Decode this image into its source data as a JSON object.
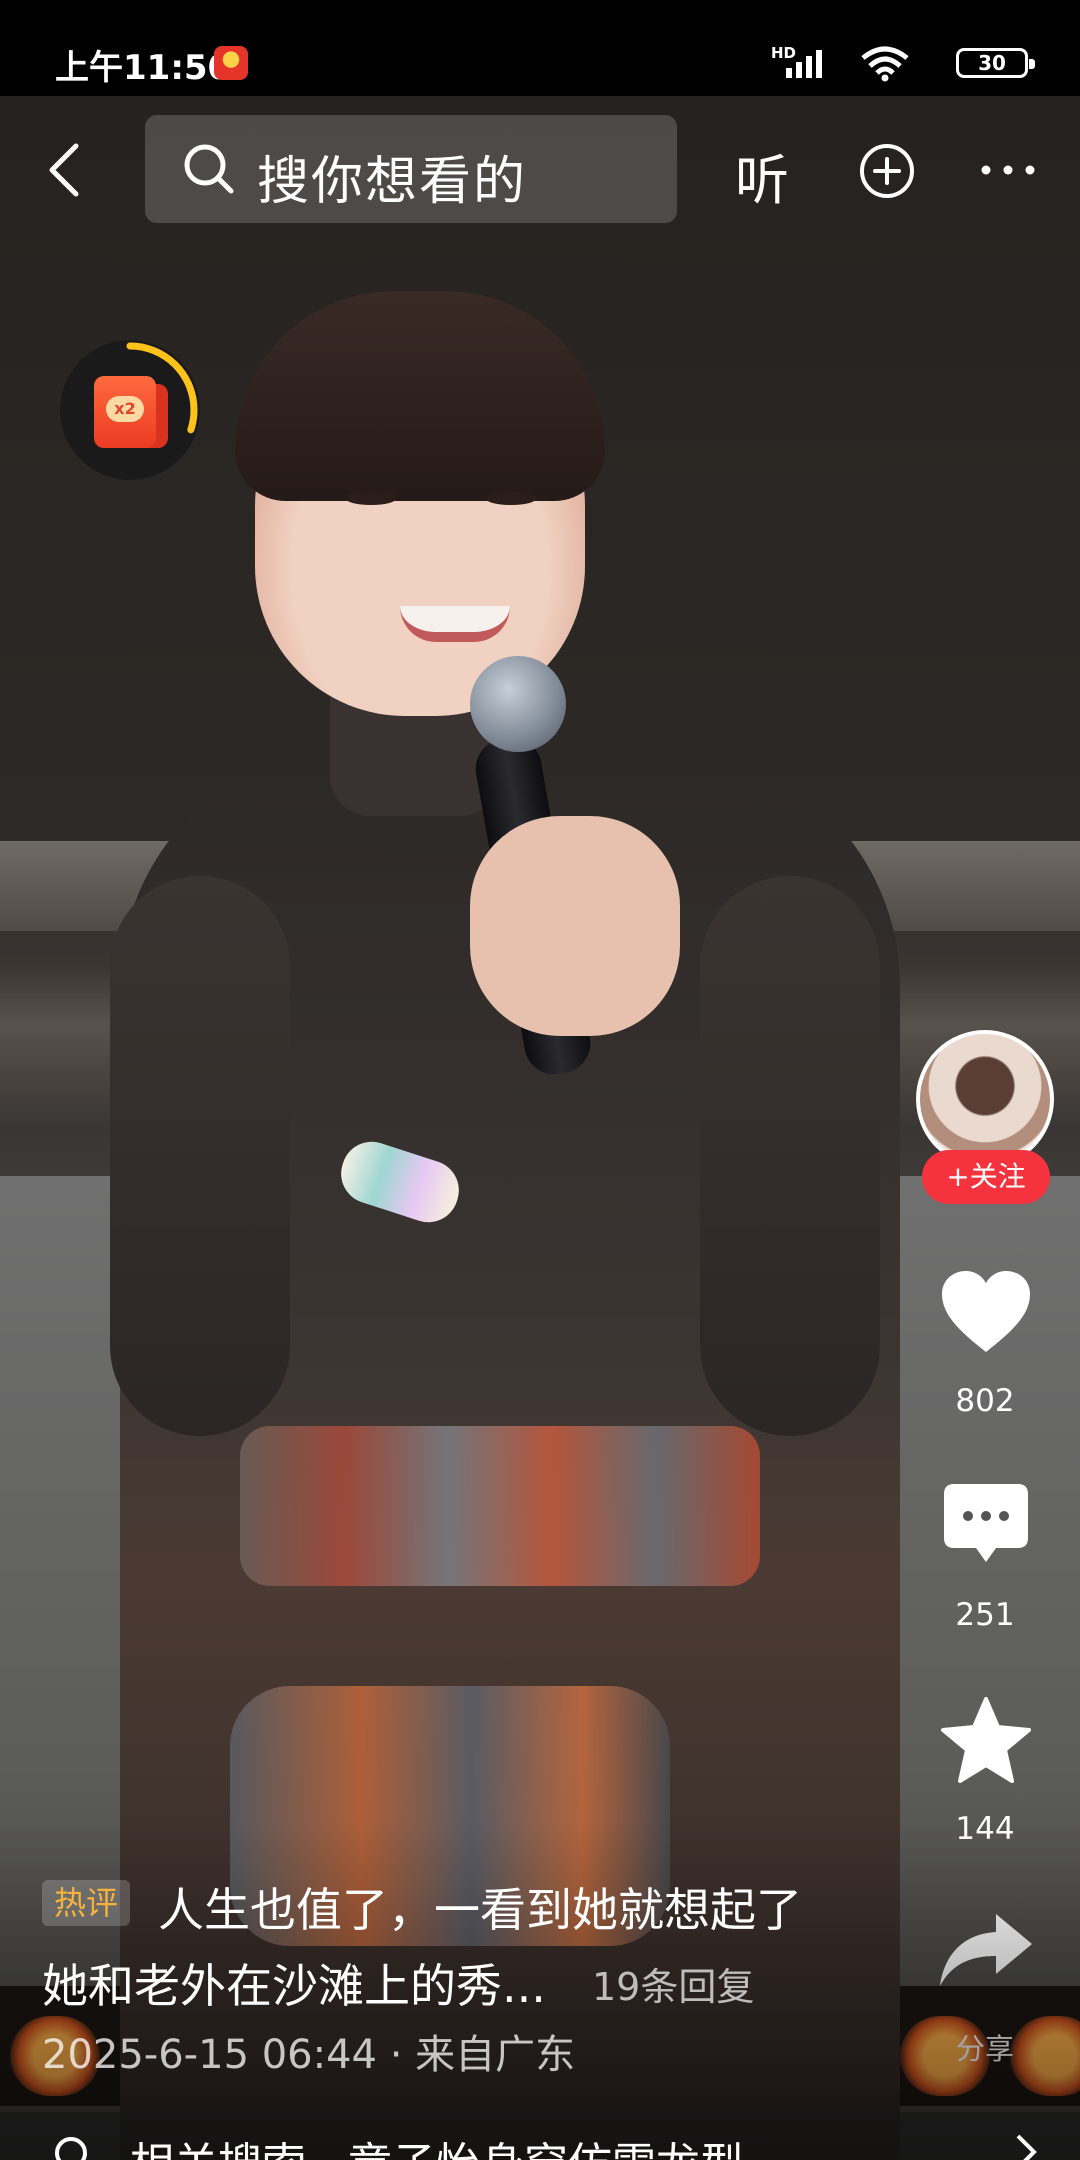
{
  "status_bar": {
    "time": "上午11:50",
    "network_label": "HD",
    "battery_level": "30",
    "app_icon": "app-notification-icon"
  },
  "top_nav": {
    "back_icon": "back-arrow-icon",
    "search_placeholder": "搜你想看的",
    "listen_label": "听",
    "add_icon": "plus-circle-icon",
    "more_icon": "more-dots-icon"
  },
  "reward_widget": {
    "badge": "x2",
    "icon": "red-packet-icon",
    "progress": 0.3
  },
  "actions": {
    "follow_label": "+关注",
    "like_count": "802",
    "comment_count": "251",
    "favorite_count": "144",
    "share_label": "分享"
  },
  "featured_comment": {
    "tag": "热评",
    "line1": "人生也值了，一看到她就想起了",
    "line2": "她和老外在沙滩上的秀...",
    "replies": "19条回复",
    "meta": "2025-6-15 06:44 · 来自广东"
  },
  "related_search": {
    "text": "相关搜索 · 章子怡身穿仿雪龙型"
  },
  "colors": {
    "follow_red": "#f5333f",
    "hot_tag": "#f5b33c",
    "reward_ring": "#ffc21a"
  }
}
